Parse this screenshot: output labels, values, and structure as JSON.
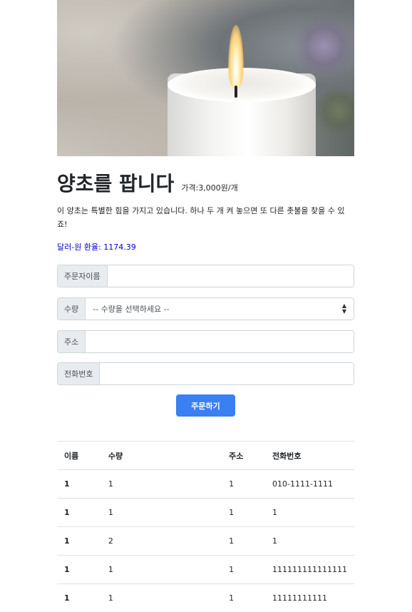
{
  "product": {
    "title": "양초를 팝니다",
    "price": "가격:3,000원/개",
    "description": "이 양초는 특별한 힘을 가지고 있습니다. 하나 두 개 켜 놓으면 또 다른 촛불을 찾을 수 있죠!",
    "exchange_rate": "달러-원 환율: 1174.39"
  },
  "form": {
    "orderer_label": "주문자이름",
    "orderer_value": "",
    "quantity_label": "수량",
    "quantity_selected": "-- 수량을 선택하세요 --",
    "address_label": "주소",
    "address_value": "",
    "phone_label": "전화번호",
    "phone_value": "",
    "submit_label": "주문하기"
  },
  "orders": {
    "headers": [
      "이름",
      "수량",
      "주소",
      "전화번호"
    ],
    "rows": [
      [
        "1",
        "1",
        "1",
        "010-1111-1111"
      ],
      [
        "1",
        "1",
        "1",
        "1"
      ],
      [
        "1",
        "2",
        "1",
        "1"
      ],
      [
        "1",
        "1",
        "1",
        "111111111111111"
      ],
      [
        "1",
        "1",
        "1",
        "11111111111"
      ]
    ]
  },
  "icons": {
    "select_arrow": "chevron-updown-icon"
  }
}
